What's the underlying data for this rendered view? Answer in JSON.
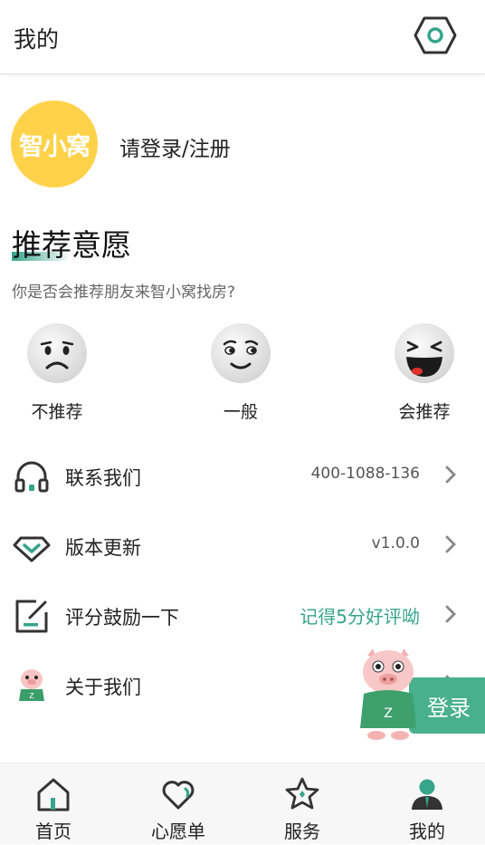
{
  "header": {
    "title": "我的",
    "settings_icon": "settings-hexagon-icon"
  },
  "profile": {
    "avatar_text": "智小窝",
    "avatar_color": "#ffd24a",
    "login_text": "请登录/注册"
  },
  "recommend": {
    "title": "推荐意愿",
    "subtitle": "你是否会推荐朋友来智小窝找房?",
    "options": [
      {
        "label": "不推荐",
        "icon": "sad-face-icon"
      },
      {
        "label": "一般",
        "icon": "neutral-face-icon"
      },
      {
        "label": "会推荐",
        "icon": "laughing-face-icon"
      }
    ]
  },
  "menu": [
    {
      "label": "联系我们",
      "value": "400-1088-136",
      "icon": "headset-icon"
    },
    {
      "label": "版本更新",
      "value": "v1.0.0",
      "icon": "diamond-update-icon"
    },
    {
      "label": "评分鼓励一下",
      "value": "记得5分好评呦",
      "icon": "edit-rating-icon"
    },
    {
      "label": "关于我们",
      "value": "",
      "icon": "mascot-pig-icon"
    }
  ],
  "float_login": {
    "label": "登录"
  },
  "tabbar": [
    {
      "label": "首页",
      "icon": "home-icon"
    },
    {
      "label": "心愿单",
      "icon": "heart-icon"
    },
    {
      "label": "服务",
      "icon": "star-icon"
    },
    {
      "label": "我的",
      "icon": "user-icon",
      "active": true
    }
  ],
  "colors": {
    "accent": "#36a58a",
    "float_button": "#49b08e"
  }
}
